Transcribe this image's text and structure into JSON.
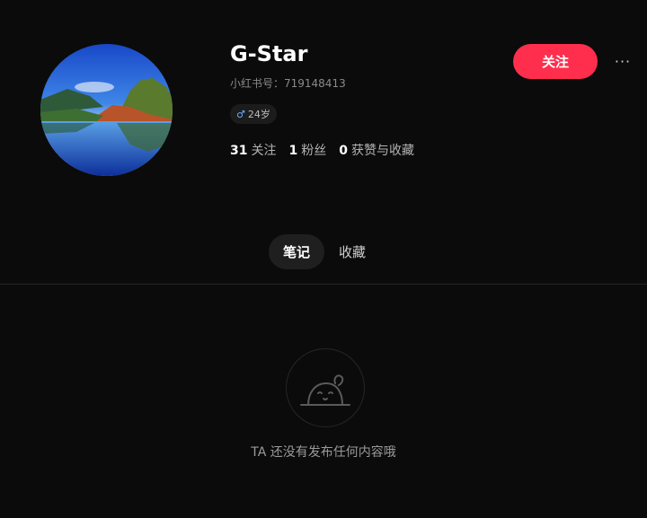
{
  "profile": {
    "username": "G-Star",
    "red_id": "小红书号：719148413",
    "gender_icon": "male-icon",
    "age": "24岁",
    "stats": [
      {
        "num": "31",
        "label": "关注"
      },
      {
        "num": "1",
        "label": "粉丝"
      },
      {
        "num": "0",
        "label": "获赞与收藏"
      }
    ],
    "follow_label": "关注",
    "more_label": "···"
  },
  "tabs": [
    {
      "label": "笔记",
      "active": true
    },
    {
      "label": "收藏",
      "active": false
    }
  ],
  "empty_state": {
    "icon": "empty-notes-icon",
    "message": "TA 还没有发布任何内容哦"
  },
  "colors": {
    "background": "#0b0b0b",
    "accent": "#ff2e4d"
  }
}
